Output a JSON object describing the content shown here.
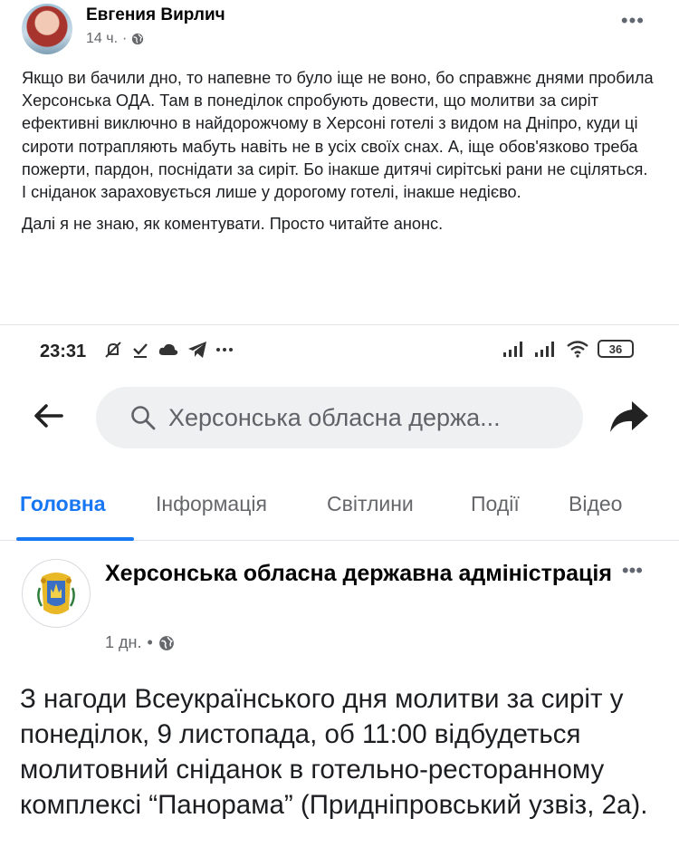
{
  "post": {
    "author": "Евгения Вирлич",
    "time": "14 ч.",
    "more_label": "•••",
    "paragraphs": [
      "Якщо ви бачили дно, то напевне то було іще не воно, бо справжнє днями пробила Херсонська ОДА. Там в понеділок спробують довести, що молитви за сиріт ефективні виключно в найдорожчому в Херсоні готелі з видом на Дніпро, куди ці сироти потрапляють мабуть навіть не в усіх своїх снах. А, іще обов'язково треба пожерти, пардон, поснідати за сиріт. Бо інакше дитячі сирітські рани не сціляться. І сніданок зараховується лише у дорогому готелі, інакше недієво.",
      "Далі я не знаю, як коментувати. Просто читайте анонс."
    ]
  },
  "phone": {
    "status_time": "23:31",
    "battery": "36",
    "search_text": "Херсонська обласна держа...",
    "tabs": [
      "Головна",
      "Інформація",
      "Світлини",
      "Події",
      "Відео"
    ],
    "page_name": "Херсонська обласна державна адміністрація",
    "page_time": "1 дн.",
    "page_more": "•••",
    "announcement": "З нагоди Всеукраїнського дня молитви за сиріт у понеділок, 9 листопада, об 11:00 відбудеться молитовний сніданок в готельно-ресторанному комплексі “Панорама” (Придніпровський узвіз, 2а)."
  },
  "icons": {
    "globe": "globe-icon",
    "back": "arrow-left-icon",
    "search": "search-icon",
    "share": "share-arrow-icon",
    "status": [
      "mute-icon",
      "check-icon",
      "cloud-icon",
      "telegram-icon",
      "more-dots-icon",
      "signal-icon",
      "signal-icon",
      "wifi-icon",
      "battery-icon"
    ]
  },
  "colors": {
    "accent": "#1877f2",
    "muted_text": "#65676b",
    "search_bg": "#eef0f2"
  }
}
